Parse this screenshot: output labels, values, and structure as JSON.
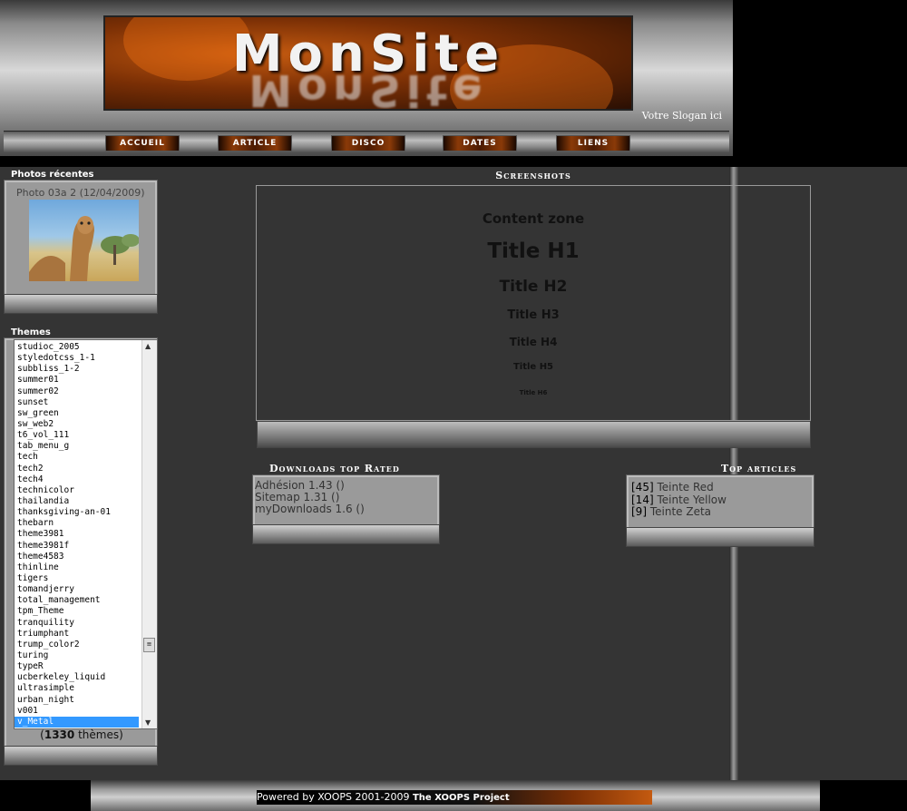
{
  "header": {
    "site_title": "MonSite",
    "slogan": "Votre Slogan ici"
  },
  "nav": {
    "items": [
      "ACCUEIL",
      "ARTICLE",
      "DISCO",
      "DATES",
      "LIENS"
    ]
  },
  "photos": {
    "title": "Photos récentes",
    "caption": "Photo 03a 2",
    "date": "(12/04/2009)",
    "image_name": "camel-photo"
  },
  "themes": {
    "title": "Themes",
    "items": [
      "studioc_2005",
      "styledotcss_1-1",
      "subbliss_1-2",
      "summer01",
      "summer02",
      "sunset",
      "sw_green",
      "sw_web2",
      "t6_vol_111",
      "tab_menu_g",
      "tech",
      "tech2",
      "tech4",
      "technicolor",
      "thailandia",
      "thanksgiving-an-01",
      "thebarn",
      "theme3981",
      "theme3981f",
      "theme4583",
      "thinline",
      "tigers",
      "tomandjerry",
      "total_management",
      "tpm_Theme",
      "tranquility",
      "triumphant",
      "trump_color2",
      "turing",
      "typeR",
      "ucberkeley_liquid",
      "ultrasimple",
      "urban_night",
      "v001",
      "v_Metal"
    ],
    "selected": "v_Metal",
    "count": "1330",
    "count_suffix": "thèmes"
  },
  "main": {
    "section_title": "Screenshots",
    "content_label": "Content zone",
    "h1": "Title H1",
    "h2": "Title H2",
    "h3": "Title H3",
    "h4": "Title H4",
    "h5": "Title H5",
    "h6": "Title H6"
  },
  "downloads": {
    "title": "Downloads top Rated",
    "items": [
      "Adhésion 1.43 ()",
      "Sitemap 1.31 ()",
      "myDownloads 1.6 ()"
    ]
  },
  "top_articles": {
    "title": "Top articles",
    "items": [
      {
        "count": "[45]",
        "label": "Teinte Red"
      },
      {
        "count": "[14]",
        "label": "Teinte Yellow"
      },
      {
        "count": "[9]",
        "label": "Teinte Zeta"
      }
    ]
  },
  "footer": {
    "prefix": "Powered by XOOPS 2001-2009",
    "project": "The XOOPS Project"
  },
  "colors": {
    "background": "#343434",
    "accent": "#c45a10",
    "selection": "#3399ff"
  }
}
